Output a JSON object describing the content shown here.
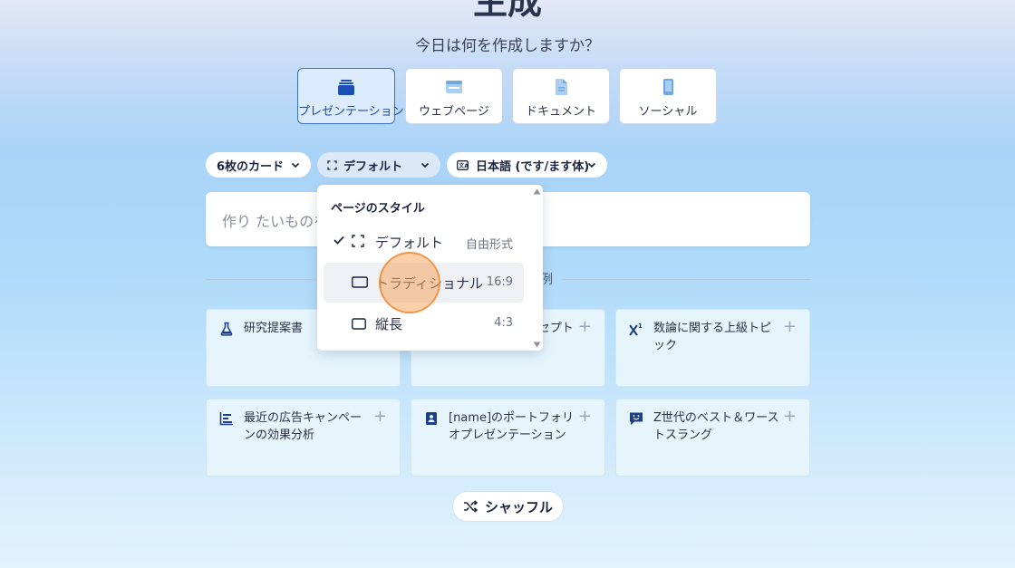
{
  "header": {
    "title": "生成",
    "subtitle": "今日は何を作成しますか？"
  },
  "content_types": [
    {
      "label": "プレゼンテーション",
      "icon": "presentation-icon",
      "selected": true
    },
    {
      "label": "ウェブページ",
      "icon": "webpage-icon",
      "selected": false
    },
    {
      "label": "ドキュメント",
      "icon": "document-icon",
      "selected": false
    },
    {
      "label": "ソーシャル",
      "icon": "social-icon",
      "selected": false
    }
  ],
  "options": {
    "card_count": "6枚のカード",
    "page_style": "デフォルト",
    "language": "日本語 (です/ます体)"
  },
  "prompt": {
    "placeholder": "作り たいものを"
  },
  "examples_label": "例",
  "examples": [
    {
      "text": "研究提案書",
      "icon": "flask-icon"
    },
    {
      "text": "デザ ュア ルコンセプトの開発",
      "icon": "design-icon"
    },
    {
      "text": "数論に関する上級トピック",
      "icon": "superscript-icon"
    },
    {
      "text": "最近の広告キャンペーンの効果分析",
      "icon": "chart-icon"
    },
    {
      "text": "[name]のポートフォリオプレゼンテーション",
      "icon": "portfolio-icon"
    },
    {
      "text": "Z世代のベスト＆ワーストスラング",
      "icon": "chat-icon"
    }
  ],
  "shuffle_label": "シャッフル",
  "dropdown": {
    "header": "ページのスタイル",
    "items": [
      {
        "label": "デフォルト",
        "meta": "自由形式",
        "selected": true
      },
      {
        "label": "トラディショナル",
        "meta": "16:9",
        "selected": false
      },
      {
        "label": "縦長",
        "meta": "4:3",
        "selected": false
      }
    ]
  },
  "colors": {
    "accent": "#3973c8",
    "icon_blue": "#1d4fb8",
    "click_indicator": "#f7a862"
  }
}
